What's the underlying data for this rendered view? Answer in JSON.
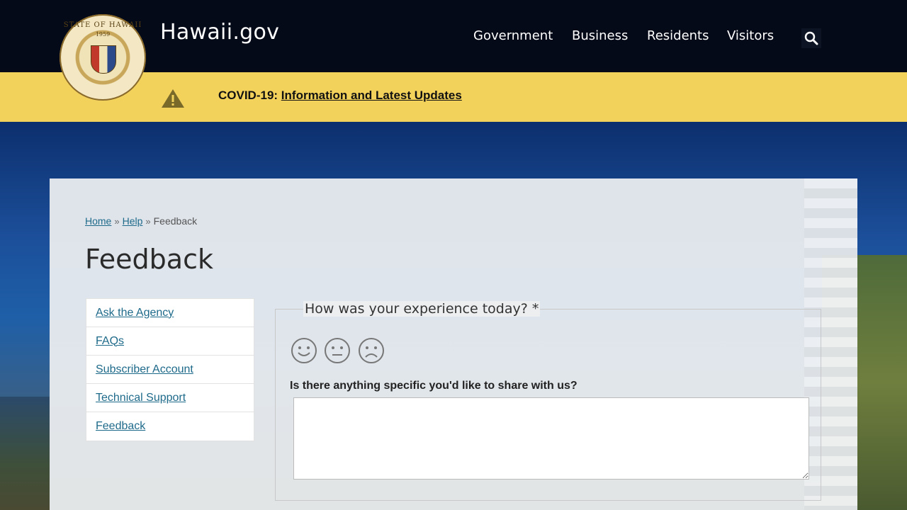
{
  "header": {
    "site_title": "Hawaii.gov",
    "seal_text": "STATE OF HAWAII",
    "seal_year": "1959",
    "nav": [
      "Government",
      "Business",
      "Residents",
      "Visitors"
    ],
    "search_icon": "search-icon",
    "bg_color": "#050a18"
  },
  "alert": {
    "prefix": "COVID-19: ",
    "link": "Information and Latest Updates",
    "icon": "warning-icon",
    "bg_color": "#f3d25c"
  },
  "breadcrumb": {
    "home": "Home",
    "help": "Help",
    "current": "Feedback"
  },
  "page": {
    "title": "Feedback"
  },
  "sidenav": {
    "items": [
      "Ask the Agency",
      "FAQs",
      "Subscriber Account",
      "Technical Support",
      "Feedback"
    ]
  },
  "form": {
    "legend": "How was your experience today? *",
    "ratings": [
      "happy-face-icon",
      "neutral-face-icon",
      "sad-face-icon"
    ],
    "question": "Is there anything specific you'd like to share with us?",
    "comment_value": ""
  },
  "colors": {
    "link": "#1e6a8a",
    "alert_bg": "#f3d25c"
  }
}
